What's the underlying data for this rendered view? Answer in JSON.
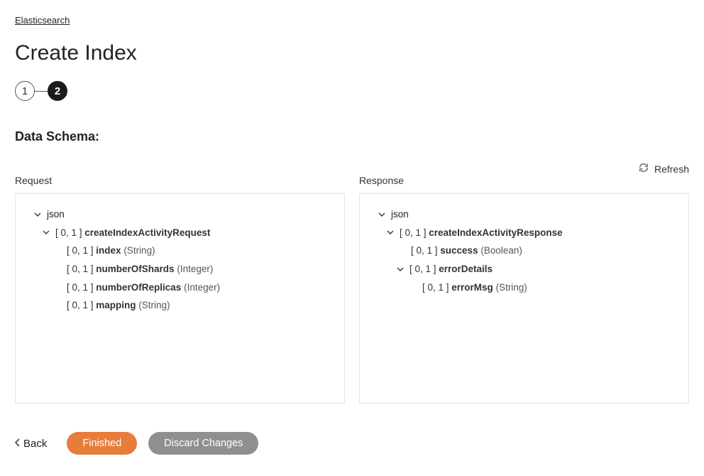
{
  "breadcrumb": "Elasticsearch",
  "page_title": "Create Index",
  "stepper": {
    "step1": "1",
    "step2": "2"
  },
  "section_title": "Data Schema:",
  "refresh_label": "Refresh",
  "columns": {
    "request": {
      "label": "Request",
      "root": "json",
      "items": [
        {
          "card": "[ 0, 1 ]",
          "name": "createIndexActivityRequest",
          "type": "",
          "expandable": true,
          "level": 1
        },
        {
          "card": "[ 0, 1 ]",
          "name": "index",
          "type": "(String)",
          "expandable": false,
          "level": 2
        },
        {
          "card": "[ 0, 1 ]",
          "name": "numberOfShards",
          "type": "(Integer)",
          "expandable": false,
          "level": 2
        },
        {
          "card": "[ 0, 1 ]",
          "name": "numberOfReplicas",
          "type": "(Integer)",
          "expandable": false,
          "level": 2
        },
        {
          "card": "[ 0, 1 ]",
          "name": "mapping",
          "type": "(String)",
          "expandable": false,
          "level": 2
        }
      ]
    },
    "response": {
      "label": "Response",
      "root": "json",
      "items": [
        {
          "card": "[ 0, 1 ]",
          "name": "createIndexActivityResponse",
          "type": "",
          "expandable": true,
          "level": 1
        },
        {
          "card": "[ 0, 1 ]",
          "name": "success",
          "type": "(Boolean)",
          "expandable": false,
          "level": 2
        },
        {
          "card": "[ 0, 1 ]",
          "name": "errorDetails",
          "type": "",
          "expandable": true,
          "level": 2
        },
        {
          "card": "[ 0, 1 ]",
          "name": "errorMsg",
          "type": "(String)",
          "expandable": false,
          "level": 3
        }
      ]
    }
  },
  "buttons": {
    "back": "Back",
    "finished": "Finished",
    "discard": "Discard Changes"
  }
}
